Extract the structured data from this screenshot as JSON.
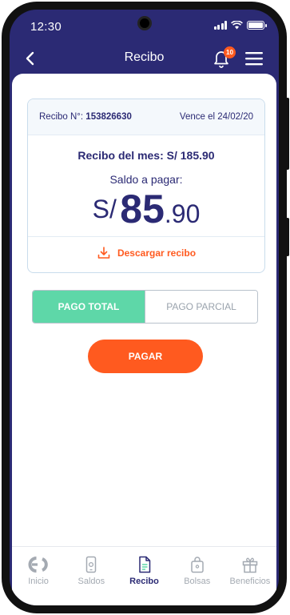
{
  "status_bar": {
    "time": "12:30"
  },
  "header": {
    "title": "Recibo",
    "notification_count": "10"
  },
  "receipt": {
    "number_label": "Recibo N°:",
    "number": "153826630",
    "due": "Vence el 24/02/20",
    "month_label": "Recibo del mes:",
    "month_amount": "S/ 185.90",
    "balance_label": "Saldo a pagar:",
    "balance_currency": "S/",
    "balance_integer": "85",
    "balance_decimal": ".90",
    "download_label": "Descargar recibo"
  },
  "payment_toggle": {
    "total_label": "PAGO TOTAL",
    "partial_label": "PAGO PARCIAL",
    "selected": "total"
  },
  "pay_button": {
    "label": "PAGAR"
  },
  "bottom_nav": {
    "items": [
      {
        "label": "Inicio",
        "icon": "brand-logo-icon"
      },
      {
        "label": "Saldos",
        "icon": "phone-icon"
      },
      {
        "label": "Recibo",
        "icon": "document-icon",
        "active": true
      },
      {
        "label": "Bolsas",
        "icon": "bag-icon"
      },
      {
        "label": "Beneficios",
        "icon": "gift-icon"
      }
    ]
  },
  "colors": {
    "primary": "#2b2a74",
    "accent": "#ff5a1f",
    "selected_toggle": "#5ed7a8",
    "muted": "#a4aab2"
  }
}
